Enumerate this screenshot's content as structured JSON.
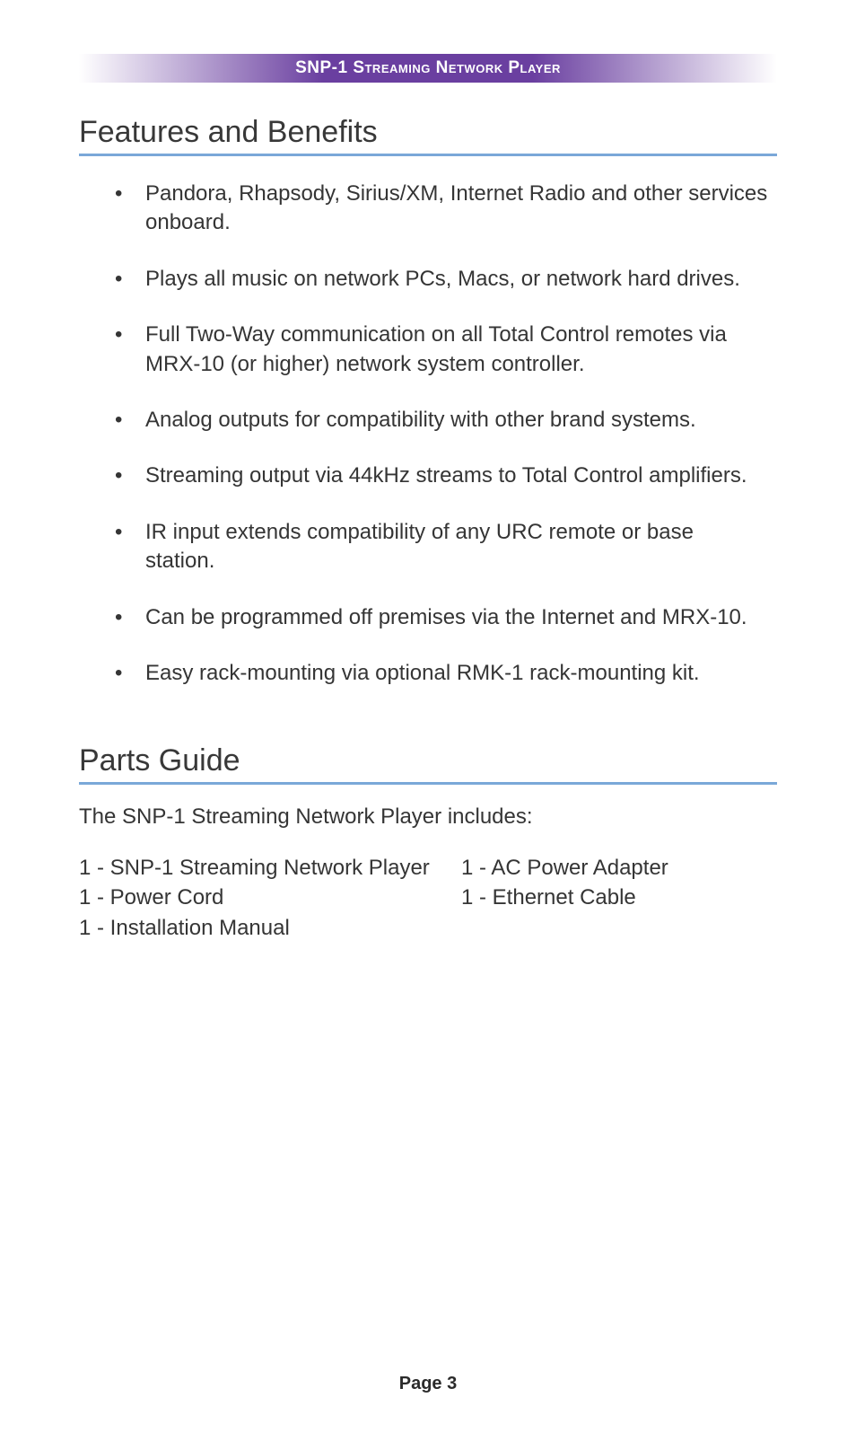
{
  "header": {
    "banner_text": "SNP-1 Streaming Network Player"
  },
  "sections": {
    "features": {
      "heading": "Features and Benefits",
      "items": [
        "Pandora, Rhapsody, Sirius/XM, Internet Radio and other services onboard.",
        "Plays all music on network PCs, Macs, or network hard drives.",
        "Full Two-Way communication on all Total Control remotes via MRX-10 (or higher) network system controller.",
        "Analog outputs for compatibility with other brand systems.",
        "Streaming output via 44kHz streams to Total Control amplifiers.",
        "IR input extends compatibility of any URC remote or base station.",
        "Can be programmed off premises via the Internet and MRX-10.",
        "Easy rack-mounting via optional RMK-1 rack-mounting kit."
      ]
    },
    "parts": {
      "heading": "Parts Guide",
      "intro": "The SNP-1 Streaming Network Player includes:",
      "left_col": [
        "1 - SNP-1 Streaming Network Player",
        "1 - Power Cord",
        "1 - Installation Manual"
      ],
      "right_col": [
        "1 - AC Power Adapter",
        "1 - Ethernet Cable"
      ]
    }
  },
  "footer": {
    "page_label": "Page 3"
  }
}
